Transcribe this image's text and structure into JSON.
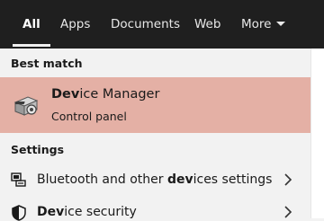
{
  "tabs": [
    {
      "label": "All"
    },
    {
      "label": "Apps"
    },
    {
      "label": "Documents"
    },
    {
      "label": "Web"
    },
    {
      "label": "More"
    }
  ],
  "best_match": {
    "header": "Best match",
    "title_match": "Dev",
    "title_rest": "ice Manager",
    "subtitle": "Control panel",
    "icon": "device-manager-icon"
  },
  "settings": {
    "header": "Settings",
    "items": [
      {
        "pre": "Bluetooth and other ",
        "match": "dev",
        "post": "ices settings",
        "icon": "bluetooth-devices-icon"
      },
      {
        "pre": "",
        "match": "Dev",
        "post": "ice security",
        "icon": "shield-icon"
      }
    ]
  },
  "colors": {
    "tabbar_bg": "#1f1f1f",
    "highlight_bg": "#e4b0a5",
    "panel_bg": "#f2f2f2"
  }
}
